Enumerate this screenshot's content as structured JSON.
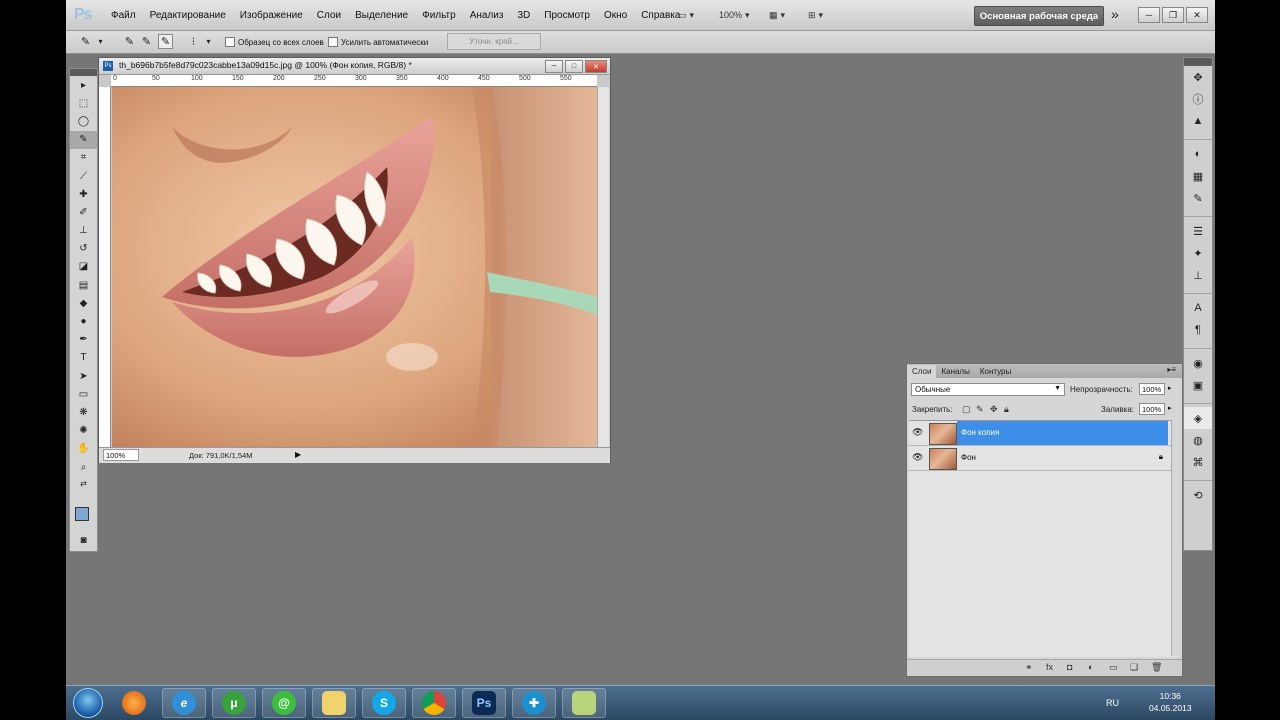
{
  "app": {
    "logo": "Ps"
  },
  "menu": [
    "Файл",
    "Редактирование",
    "Изображение",
    "Слои",
    "Выделение",
    "Фильтр",
    "Анализ",
    "3D",
    "Просмотр",
    "Окно",
    "Справка"
  ],
  "menubar_controls": {
    "zoom": "100%"
  },
  "workspace_label": "Основная рабочая среда",
  "options_bar": {
    "sample_all_layers": "Образец со всех слоев",
    "auto_enhance": "Усилить автоматически",
    "refine_edge": "Уточн. край..."
  },
  "document": {
    "title": "th_b696b7b5fe8d79c023cabbe13a09d15c.jpg @ 100% (Фон копия, RGB/8) *",
    "ruler_ticks": [
      "0",
      "50",
      "100",
      "150",
      "200",
      "250",
      "300",
      "350",
      "400",
      "450",
      "500",
      "550"
    ],
    "zoom": "100%",
    "doc_info": "Док: 791,0K/1,54M"
  },
  "layers_panel": {
    "tabs": [
      "Слои",
      "Каналы",
      "Контуры"
    ],
    "blend_mode": "Обычные",
    "opacity_label": "Непрозрачность:",
    "opacity_value": "100%",
    "lock_label": "Закрепить:",
    "fill_label": "Заливка:",
    "fill_value": "100%",
    "layers": [
      {
        "name": "Фон копия",
        "active": true
      },
      {
        "name": "Фон",
        "active": false,
        "locked": true
      }
    ]
  },
  "taskbar": {
    "language": "RU",
    "time": "10:36",
    "date": "04.05.2013",
    "apps": [
      "start-orb",
      "firefox-icon",
      "ie-icon",
      "utorrent-icon",
      "mail-agent-icon",
      "explorer-folder-icon",
      "skype-icon",
      "chrome-icon",
      "photoshop-icon",
      "medical-plus-icon",
      "notes-icon"
    ]
  },
  "colors": {
    "accent_selected_layer": "#3d8ee8",
    "foreground_swatch": "#7ea8d4",
    "canvas_bg": "#767676"
  }
}
